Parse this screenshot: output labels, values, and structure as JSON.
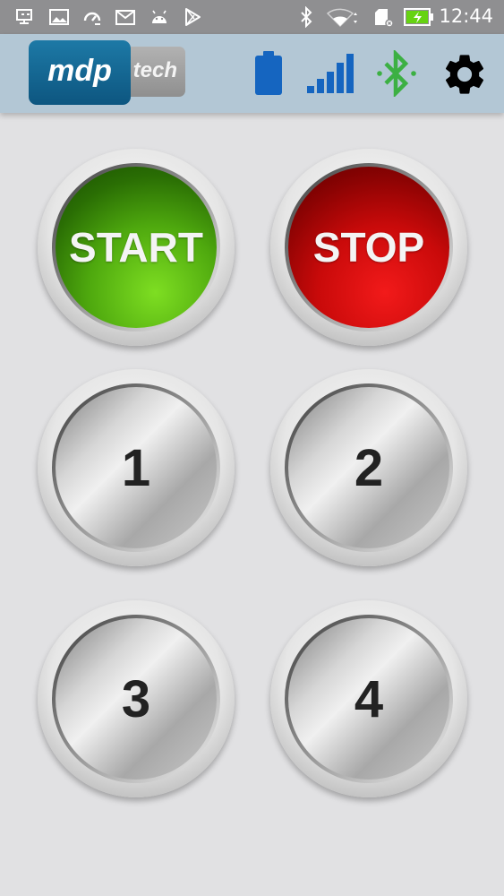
{
  "status_bar": {
    "time": "12:44",
    "left_icons": [
      "screen-cast-icon",
      "gallery-icon",
      "speed-icon",
      "gmail-icon",
      "android-debug-icon",
      "play-store-icon"
    ],
    "right_icons": [
      "bluetooth-icon",
      "wifi-icon",
      "sd-card-icon",
      "battery-charging-icon"
    ]
  },
  "app_bar": {
    "logo": {
      "primary": "mdp",
      "secondary": "tech",
      "colors": {
        "primary_bg": "#0d5680",
        "secondary_bg": "#999999"
      }
    },
    "icons": [
      "battery-icon",
      "signal-strength-icon",
      "bluetooth-icon",
      "settings-gear-icon"
    ],
    "colors": {
      "background": "#b3c7d5",
      "battery": "#1565c0",
      "signal": "#1565c0",
      "bluetooth": "#3cb043",
      "gear": "#000000"
    }
  },
  "buttons": {
    "start": {
      "label": "START",
      "color": "#4ea80e"
    },
    "stop": {
      "label": "STOP",
      "color": "#c90a0a"
    },
    "one": {
      "label": "1"
    },
    "two": {
      "label": "2"
    },
    "three": {
      "label": "3"
    },
    "four": {
      "label": "4"
    }
  }
}
